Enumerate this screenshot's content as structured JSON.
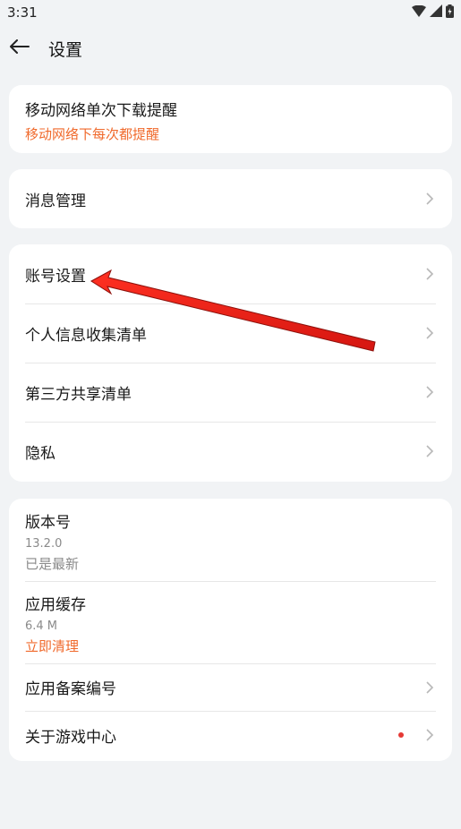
{
  "status": {
    "time": "3:31"
  },
  "header": {
    "title": "设置"
  },
  "download_card": {
    "title": "移动网络单次下载提醒",
    "subtitle": "移动网络下每次都提醒"
  },
  "message_card": {
    "label": "消息管理"
  },
  "account_card": {
    "items": [
      {
        "label": "账号设置"
      },
      {
        "label": "个人信息收集清单"
      },
      {
        "label": "第三方共享清单"
      },
      {
        "label": "隐私"
      }
    ]
  },
  "about_card": {
    "version_label": "版本号",
    "version_value": "13.2.0",
    "version_status": "已是最新",
    "cache_label": "应用缓存",
    "cache_size": "6.4 M",
    "cache_action": "立即清理",
    "filing_label": "应用备案编号",
    "about_label": "关于游戏中心"
  },
  "colors": {
    "accent": "#f06a2c",
    "badge": "#e53935",
    "annotation_arrow": "#e8120c"
  }
}
